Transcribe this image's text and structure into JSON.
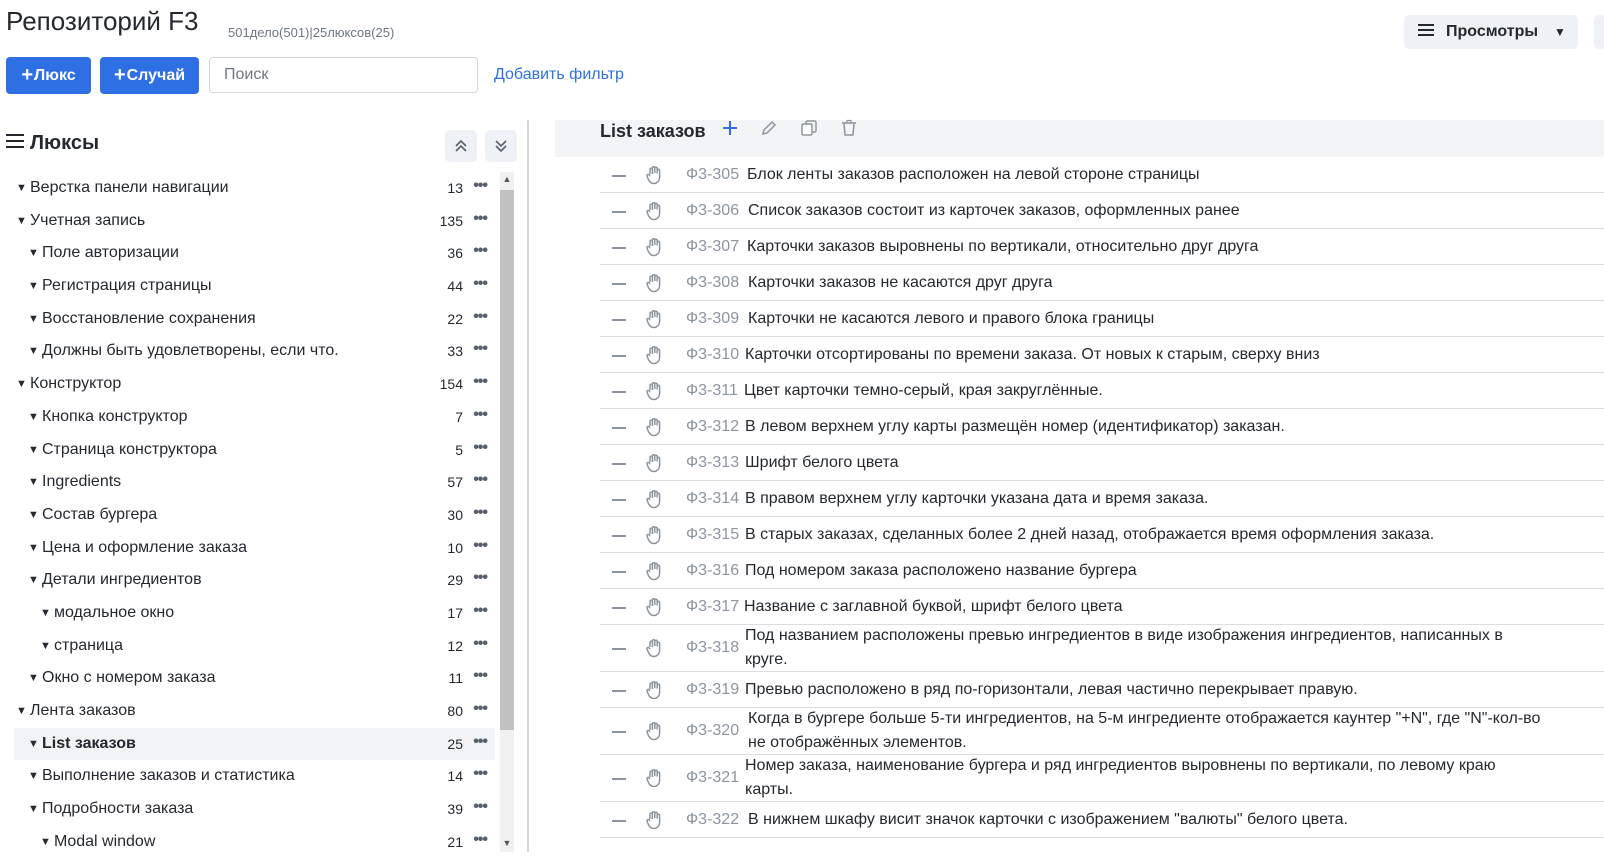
{
  "header": {
    "title": "Репозиторий F3",
    "stats": "501дело(501)|25люксов(25)",
    "views_label": "Просмотры"
  },
  "toolbar": {
    "suite_plus": "+",
    "suite_label": "Люкс",
    "case_plus": "+",
    "case_label": "Случай",
    "search_placeholder": "Поиск",
    "add_filter": "Добавить фильтр"
  },
  "sidebar": {
    "title": "Люксы",
    "items": [
      {
        "label": "Верстка панели навигации",
        "count": "13"
      },
      {
        "label": "Учетная запись",
        "count": "135"
      },
      {
        "label": "Поле авторизации",
        "count": "36"
      },
      {
        "label": "Регистрация страницы",
        "count": "44"
      },
      {
        "label": "Восстановление сохранения",
        "count": "22"
      },
      {
        "label": "Должны быть удовлетворены, если что.",
        "count": "33"
      },
      {
        "label": "Конструктор",
        "count": "154"
      },
      {
        "label": "Кнопка конструктор",
        "count": "7"
      },
      {
        "label": "Страница конструктора",
        "count": "5"
      },
      {
        "label": "Ingredients",
        "count": "57"
      },
      {
        "label": "Состав бургера",
        "count": "30"
      },
      {
        "label": "Цена и оформление заказа",
        "count": "10"
      },
      {
        "label": "Детали ингредиентов",
        "count": "29"
      },
      {
        "label": "модальное окно",
        "count": "17"
      },
      {
        "label": "страница",
        "count": "12"
      },
      {
        "label": "Окно с номером заказа",
        "count": "11"
      },
      {
        "label": "Лента заказов",
        "count": "80"
      },
      {
        "label": "List заказов",
        "count": "25"
      },
      {
        "label": "Выполнение заказов и статистика",
        "count": "14"
      },
      {
        "label": "Подробности заказа",
        "count": "39"
      },
      {
        "label": "Modal window",
        "count": "21"
      }
    ]
  },
  "section": {
    "title": "List заказов",
    "cases": [
      {
        "id": "Ф3-305",
        "text": "Блок ленты заказов расположен на левой стороне страницы"
      },
      {
        "id": "Ф3-306",
        "text": "Список заказов состоит из карточек заказов, оформленных ранее"
      },
      {
        "id": "Ф3-307",
        "text": "Карточки заказов выровнены по вертикали, относительно друг друга"
      },
      {
        "id": "Ф3-308",
        "text": "Карточки заказов не касаются друг друга"
      },
      {
        "id": "Ф3-309",
        "text": "Карточки не касаются левого и правого блока границы"
      },
      {
        "id": "Ф3-310",
        "text": "Карточки отсортированы по времени заказа. От новых к старым, сверху вниз"
      },
      {
        "id": "Ф3-311",
        "text": "Цвет карточки темно-серый, края закруглённые."
      },
      {
        "id": "Ф3-312",
        "text": "В левом верхнем углу карты размещён номер (идентификатор) заказан."
      },
      {
        "id": "Ф3-313",
        "text": "Шрифт белого цвета"
      },
      {
        "id": "Ф3-314",
        "text": "В правом верхнем углу карточки указана дата и время заказа."
      },
      {
        "id": "Ф3-315",
        "text": "В старых заказах, сделанных более 2 дней назад, отображается время оформления заказа."
      },
      {
        "id": "Ф3-316",
        "text": "Под номером заказа расположено название бургера"
      },
      {
        "id": "Ф3-317",
        "text": "Название с заглавной буквой, шрифт белого цвета"
      },
      {
        "id": "Ф3-318",
        "text": "Под названием расположены превью ингредиентов в виде изображения ингредиентов, написанных в круге."
      },
      {
        "id": "Ф3-319",
        "text": "Превью расположено в ряд по-горизонтали, левая частично перекрывает правую."
      },
      {
        "id": "Ф3-320",
        "text": "Когда в бургере больше 5-ти ингредиентов, на 5-м ингредиенте отображается каунтер \"+N\", где \"N\"-кол-во не отображённых элементов."
      },
      {
        "id": "Ф3-321",
        "text": "Номер заказа, наименование бургера и ряд ингредиентов выровнены по вертикали, по левому краю карты."
      },
      {
        "id": "Ф3-322",
        "text": "В нижнем шкафу висит значок карточки с изображением \"валюты\" белого цвета."
      }
    ]
  },
  "colors": {
    "primary": "#2f6fe4",
    "muted": "#8c959f"
  },
  "icons": [
    "menu-icon",
    "chevron-down-icon",
    "chevrons-up-icon",
    "chevrons-down-icon",
    "plus-icon",
    "pencil-icon",
    "copy-icon",
    "trash-icon",
    "hand-icon",
    "more-icon"
  ]
}
